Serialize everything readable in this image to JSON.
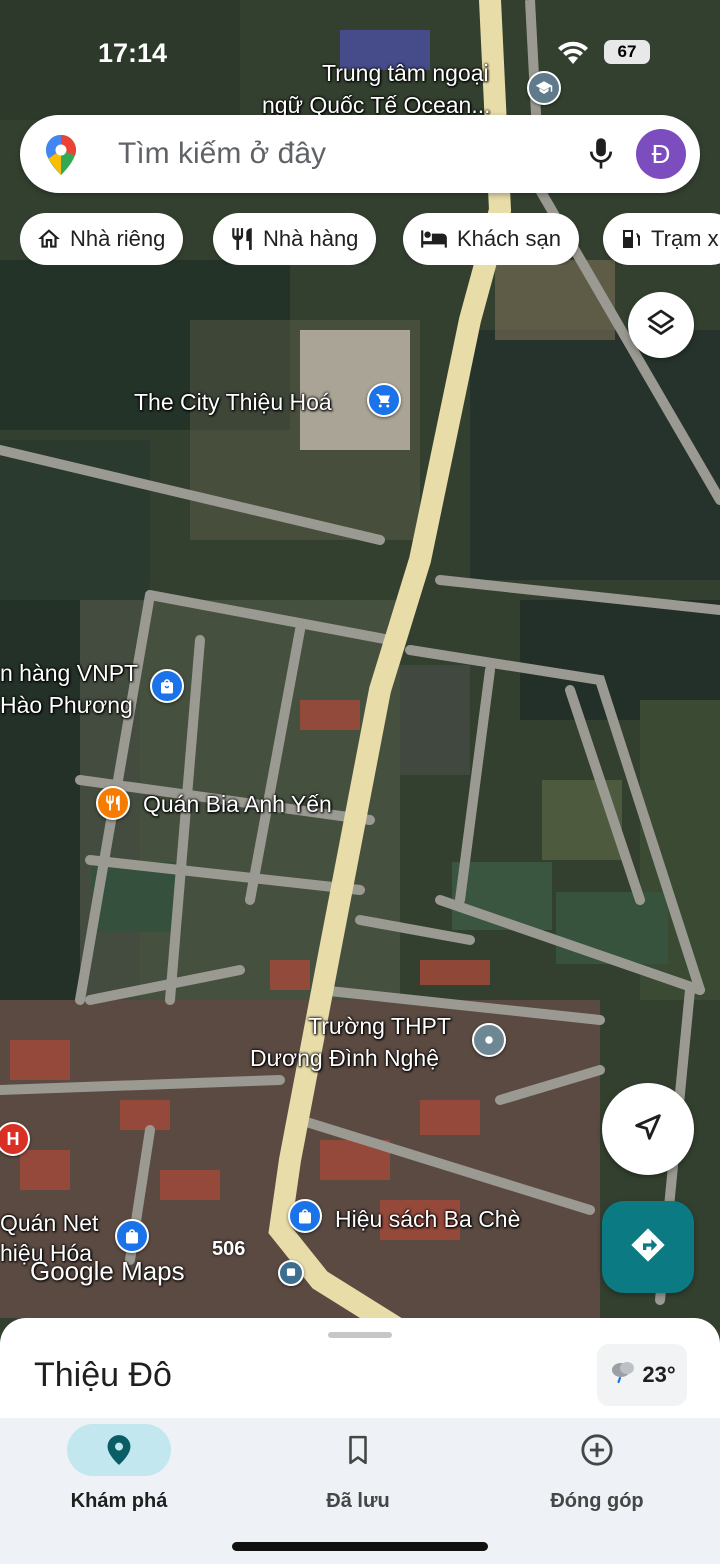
{
  "status_bar": {
    "time": "17:14",
    "battery": "67"
  },
  "search": {
    "placeholder": "Tìm kiếm ở đây",
    "avatar_letter": "Đ"
  },
  "chips": [
    {
      "label": "Nhà riêng",
      "icon": "home-icon"
    },
    {
      "label": "Nhà hàng",
      "icon": "restaurant-icon"
    },
    {
      "label": "Khách sạn",
      "icon": "hotel-icon"
    },
    {
      "label": "Trạm x",
      "icon": "gas-station-icon"
    }
  ],
  "map": {
    "labels": {
      "ocean_line1": "Trung tâm ngoại",
      "ocean_line2": "ngữ Quốc Tế Ocean...",
      "city": "The City Thiệu Hoá",
      "vnpt_line1": "n hàng VNPT",
      "vnpt_line2": "Hào Phương",
      "quan_bia": "Quán Bia Anh Yến",
      "truong_line1": "Trường THPT",
      "truong_line2": "Dương Đình Nghệ",
      "hieu_sach": "Hiệu sách Ba Chè",
      "quan_net_line1": "Quán Net",
      "quan_net_line2": "hiệu Hóa",
      "road_number": "506",
      "hospital_marker": "H",
      "google_logo": "Google Maps"
    },
    "colors": {
      "shopping": "#1a73e8",
      "food": "#f57c00",
      "school": "#5f7a8a",
      "hospital": "#d93025"
    }
  },
  "sheet": {
    "place_name": "Thiệu Đô",
    "temperature": "23°"
  },
  "bottom_nav": [
    {
      "label": "Khám phá",
      "icon": "explore-pin-icon",
      "active": true
    },
    {
      "label": "Đã lưu",
      "icon": "bookmark-icon",
      "active": false
    },
    {
      "label": "Đóng góp",
      "icon": "add-circle-icon",
      "active": false
    }
  ],
  "accent_color": "#0b7a83"
}
